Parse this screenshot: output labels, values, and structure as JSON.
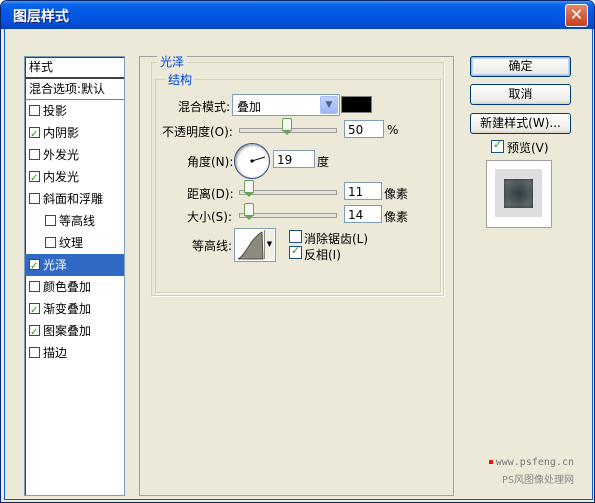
{
  "window": {
    "title": "图层样式",
    "close_glyph": "✕"
  },
  "list": {
    "header": "样式",
    "blend_options": "混合选项:默认",
    "items": [
      {
        "label": "投影",
        "checked": false,
        "indent": false,
        "selected": false
      },
      {
        "label": "内阴影",
        "checked": true,
        "indent": false,
        "selected": false
      },
      {
        "label": "外发光",
        "checked": false,
        "indent": false,
        "selected": false
      },
      {
        "label": "内发光",
        "checked": true,
        "indent": false,
        "selected": false
      },
      {
        "label": "斜面和浮雕",
        "checked": false,
        "indent": false,
        "selected": false
      },
      {
        "label": "等高线",
        "checked": false,
        "indent": true,
        "selected": false
      },
      {
        "label": "纹理",
        "checked": false,
        "indent": true,
        "selected": false
      },
      {
        "label": "光泽",
        "checked": true,
        "indent": false,
        "selected": true
      },
      {
        "label": "颜色叠加",
        "checked": false,
        "indent": false,
        "selected": false
      },
      {
        "label": "渐变叠加",
        "checked": true,
        "indent": false,
        "selected": false
      },
      {
        "label": "图案叠加",
        "checked": true,
        "indent": false,
        "selected": false
      },
      {
        "label": "描边",
        "checked": false,
        "indent": false,
        "selected": false
      }
    ]
  },
  "panel": {
    "section_title": "光泽",
    "group_title": "结构",
    "blend_mode_label": "混合模式:",
    "blend_mode_value": "叠加",
    "color": "#000000",
    "opacity_label": "不透明度(O):",
    "opacity_value": "50",
    "opacity_unit": "%",
    "opacity_fraction": 0.5,
    "angle_label": "角度(N):",
    "angle_value": "19",
    "angle_unit": "度",
    "distance_label": "距离(D):",
    "distance_value": "11",
    "distance_unit": "像素",
    "size_label": "大小(S):",
    "size_value": "14",
    "size_unit": "像素",
    "contour_label": "等高线:",
    "antialias_label": "消除锯齿(L)",
    "antialias_checked": false,
    "invert_label": "反相(I)",
    "invert_checked": true
  },
  "buttons": {
    "ok": "确定",
    "cancel": "取消",
    "new_style": "新建样式(W)...",
    "preview_label": "预览(V)",
    "preview_checked": true
  },
  "watermark": {
    "line1": "www.psfeng.cn",
    "line2": "PS风图像处理网"
  },
  "colors": {
    "selection": "#316ac5",
    "titlebar": "#0058e6",
    "group_label": "#0046d5",
    "check": "#21a121"
  }
}
